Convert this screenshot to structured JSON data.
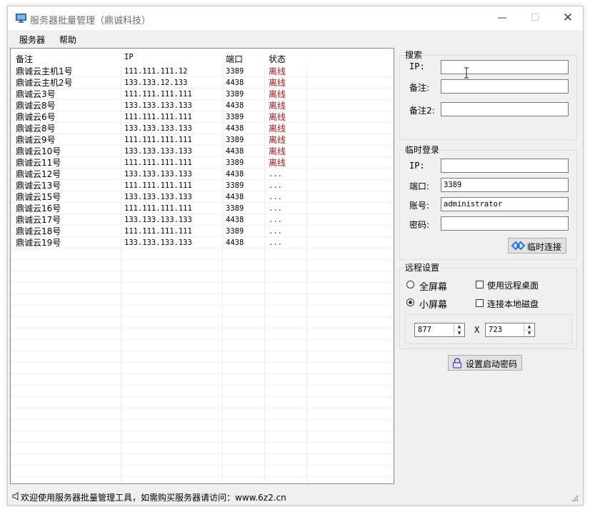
{
  "window": {
    "title": "服务器批量管理（鼎诚科技）",
    "controls": {
      "minimize": "—",
      "maximize": "☐",
      "close": "✕"
    }
  },
  "menu": [
    "服务器",
    "帮助"
  ],
  "table": {
    "columns": [
      "备注",
      "IP",
      "端口",
      "状态"
    ],
    "rows": [
      {
        "note": "鼎诚云主机1号",
        "ip": "111.111.111.12",
        "port": "3389",
        "status": "离线",
        "state": "offline"
      },
      {
        "note": "鼎诚云主机2号",
        "ip": "133.133.12.133",
        "port": "4438",
        "status": "离线",
        "state": "offline"
      },
      {
        "note": "鼎诚云3号",
        "ip": "111.111.111.111",
        "port": "3389",
        "status": "离线",
        "state": "offline"
      },
      {
        "note": "鼎诚云8号",
        "ip": "133.133.133.133",
        "port": "4438",
        "status": "离线",
        "state": "offline"
      },
      {
        "note": "鼎诚云6号",
        "ip": "111.111.111.111",
        "port": "3389",
        "status": "离线",
        "state": "offline"
      },
      {
        "note": "鼎诚云8号",
        "ip": "133.133.133.133",
        "port": "4438",
        "status": "离线",
        "state": "offline"
      },
      {
        "note": "鼎诚云9号",
        "ip": "111.111.111.111",
        "port": "3389",
        "status": "离线",
        "state": "offline"
      },
      {
        "note": "鼎诚云10号",
        "ip": "133.133.133.133",
        "port": "4438",
        "status": "离线",
        "state": "offline"
      },
      {
        "note": "鼎诚云11号",
        "ip": "111.111.111.111",
        "port": "3389",
        "status": "离线",
        "state": "offline"
      },
      {
        "note": "鼎诚云12号",
        "ip": "133.133.133.133",
        "port": "4438",
        "status": "...",
        "state": "unknown"
      },
      {
        "note": "鼎诚云13号",
        "ip": "111.111.111.111",
        "port": "3389",
        "status": "...",
        "state": "unknown"
      },
      {
        "note": "鼎诚云15号",
        "ip": "133.133.133.133",
        "port": "4438",
        "status": "...",
        "state": "unknown"
      },
      {
        "note": "鼎诚云16号",
        "ip": "111.111.111.111",
        "port": "3389",
        "status": "...",
        "state": "unknown"
      },
      {
        "note": "鼎诚云17号",
        "ip": "133.133.133.133",
        "port": "4438",
        "status": "...",
        "state": "unknown"
      },
      {
        "note": "鼎诚云18号",
        "ip": "111.111.111.111",
        "port": "3389",
        "status": "...",
        "state": "unknown"
      },
      {
        "note": "鼎诚云19号",
        "ip": "133.133.133.133",
        "port": "4438",
        "status": "...",
        "state": "unknown"
      }
    ]
  },
  "search": {
    "title": "搜索",
    "ip_label": "IP:",
    "ip_value": "",
    "note_label": "备注:",
    "note_value": "",
    "note2_label": "备注2:",
    "note2_value": ""
  },
  "temp_login": {
    "title": "临时登录",
    "ip_label": "IP:",
    "ip_value": "",
    "port_label": "端口:",
    "port_value": "3389",
    "account_label": "账号:",
    "account_value": "administrator",
    "password_label": "密码:",
    "password_value": "",
    "connect_button": "临时连接"
  },
  "remote": {
    "title": "远程设置",
    "fullscreen_label": "全屏幕",
    "fullscreen_checked": false,
    "small_label": "小屏幕",
    "small_checked": true,
    "remote_desktop_label": "使用远程桌面",
    "remote_desktop_checked": false,
    "local_disk_label": "连接本地磁盘",
    "local_disk_checked": false,
    "width": "877",
    "x_label": "X",
    "height": "723"
  },
  "set_password_button": "设置启动密码",
  "status_text": "欢迎使用服务器批量管理工具，如需购买服务器请访问：www.6z2.cn",
  "colors": {
    "offline": "#b01818",
    "accent": "#1e78d7"
  },
  "icons": [
    "monitor-icon",
    "link-icon",
    "lock-icon",
    "speaker-icon",
    "resize-grip-icon",
    "text-cursor-icon"
  ]
}
